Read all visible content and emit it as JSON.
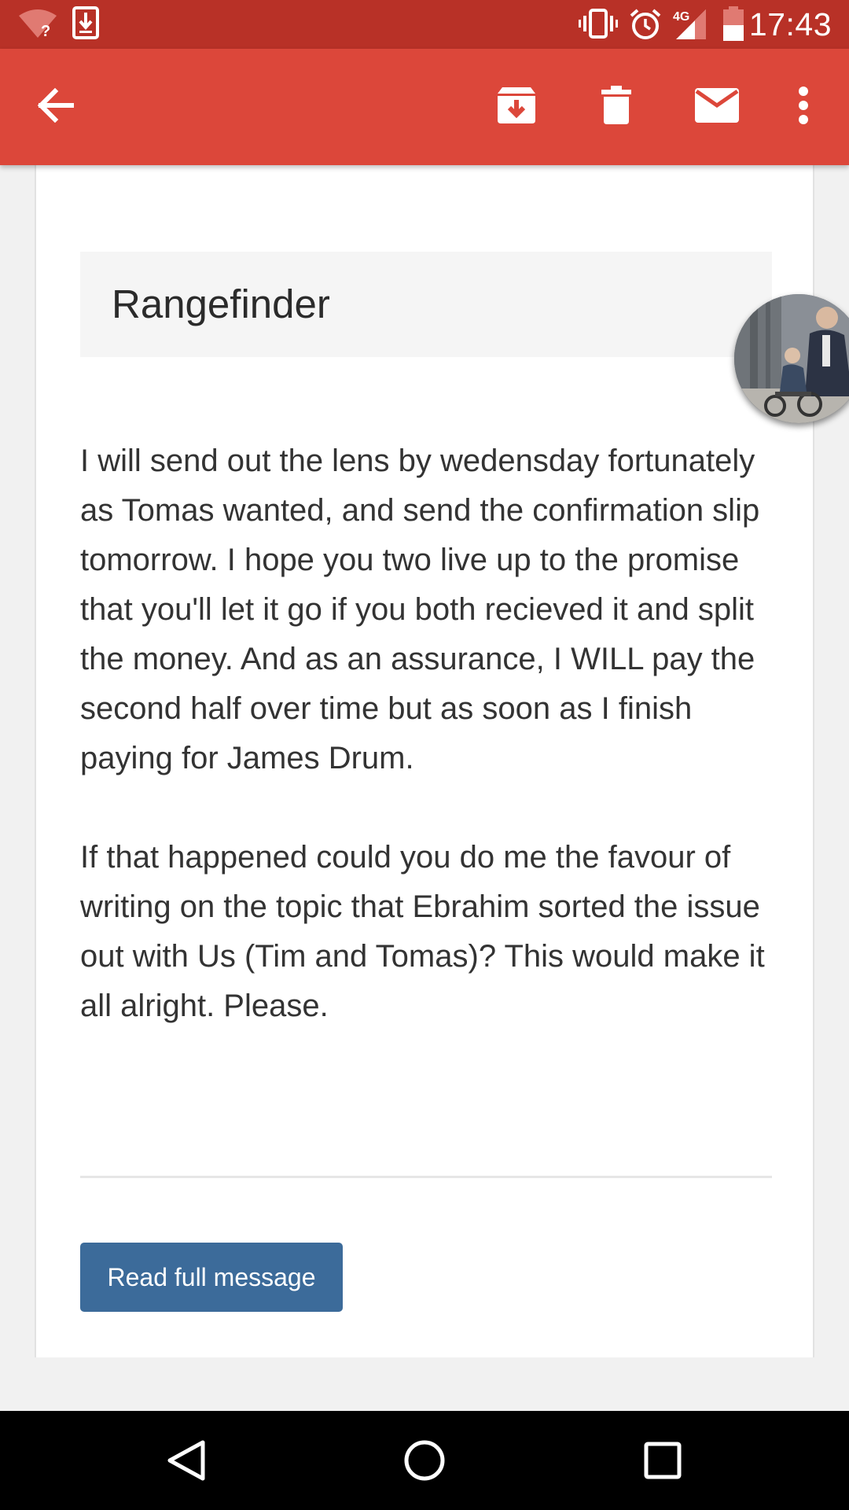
{
  "status_bar": {
    "time": "17:43",
    "network": "4G",
    "icons": [
      "wifi-unknown-icon",
      "download-icon",
      "vibrate-icon",
      "alarm-icon",
      "signal-icon",
      "battery-icon"
    ]
  },
  "toolbar": {
    "icons": [
      "back-arrow-icon",
      "archive-icon",
      "delete-icon",
      "mark-unread-icon",
      "more-options-icon"
    ]
  },
  "email": {
    "subject": "Rangefinder",
    "paragraphs": [
      "I will send out the lens by wedensday fortunately as Tomas wanted, and send the confirmation slip tomorrow. I hope you two live up to the promise that you'll let it go if you both recieved it and split the money. And as an assurance, I WILL pay the second half over time but as soon as I finish paying for James Drum.",
      "If that happened could you do me the favour of writing on the topic that Ebrahim sorted the issue out with Us (Tim and Tomas)? This would make it all alright. Please."
    ],
    "read_full_label": "Read full message"
  },
  "nav_bar": {
    "icons": [
      "back-triangle-icon",
      "home-circle-icon",
      "recents-square-icon"
    ]
  },
  "colors": {
    "status_bar": "#b83127",
    "app_bar": "#dc473a",
    "button": "#3c6b9a"
  }
}
